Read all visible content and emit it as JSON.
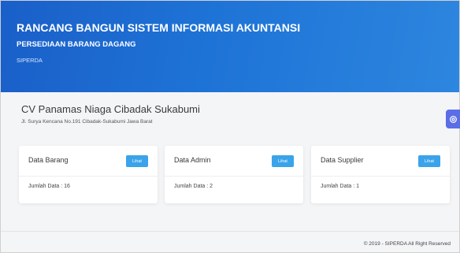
{
  "header": {
    "title": "RANCANG BANGUN SISTEM INFORMASI AKUNTANSI",
    "subtitle": "PERSEDIAAN BARANG DAGANG",
    "app_name": "SIPERDA"
  },
  "company": {
    "name": "CV Panamas Niaga Cibadak Sukabumi",
    "address": "Jl. Surya Kencana No.191 Cibadak-Sukabumi Jawa Barat"
  },
  "cards": [
    {
      "title": "Data Barang",
      "button": "Lihat",
      "count": "Jumlah Data : 16"
    },
    {
      "title": "Data Admin",
      "button": "Lihat",
      "count": "Jumlah Data : 2"
    },
    {
      "title": "Data Supplier",
      "button": "Lihat",
      "count": "Jumlah Data : 1"
    }
  ],
  "footer": {
    "copyright": "© 2019 - SIPERDA All Right Reserved"
  },
  "colors": {
    "header_gradient_start": "#1a5fc9",
    "header_gradient_end": "#2d86df",
    "button": "#3aa3ea",
    "settings_button": "#5b6ee8"
  },
  "icons": {
    "settings": "gear-icon"
  }
}
